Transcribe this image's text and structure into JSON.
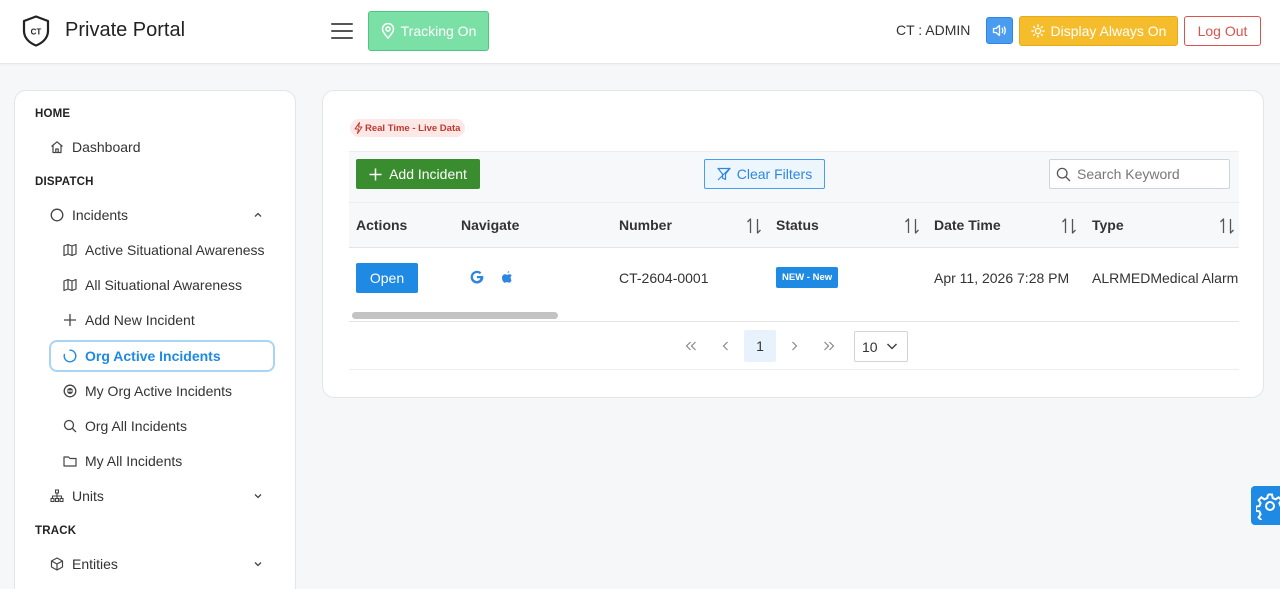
{
  "header": {
    "brand": "Private Portal",
    "logo_text": "CT",
    "tracking_label": "Tracking On",
    "user_label": "CT : ADMIN",
    "display_label": "Display Always On",
    "logout_label": "Log Out"
  },
  "sidebar": {
    "sections": {
      "home": "HOME",
      "dispatch": "DISPATCH",
      "track": "TRACK"
    },
    "items": {
      "dashboard": "Dashboard",
      "incidents": "Incidents",
      "active_sa": "Active Situational Awareness",
      "all_sa": "All Situational Awareness",
      "add_incident": "Add New Incident",
      "org_active": "Org Active Incidents",
      "my_org_active": "My Org Active Incidents",
      "org_all": "Org All Incidents",
      "my_all": "My All Incidents",
      "units": "Units",
      "entities": "Entities"
    }
  },
  "main": {
    "realtime_badge": "Real Time - Live Data",
    "add_button": "Add Incident",
    "clear_button": "Clear Filters",
    "search_placeholder": "Search Keyword",
    "columns": {
      "actions": "Actions",
      "navigate": "Navigate",
      "number": "Number",
      "status": "Status",
      "datetime": "Date Time",
      "type": "Type"
    },
    "rows": [
      {
        "action": "Open",
        "number": "CT-2604-0001",
        "status": "NEW - New",
        "datetime": "Apr 11, 2026 7:28 PM",
        "type": "ALRMEDMedical Alarm"
      }
    ],
    "pagination": {
      "current_page": "1",
      "page_size": "10"
    }
  },
  "colors": {
    "primary": "#1f8ae3",
    "success": "#3a8d2f",
    "tracking": "#7be0a5",
    "warning": "#f5bd2c",
    "danger": "#d9534f"
  }
}
